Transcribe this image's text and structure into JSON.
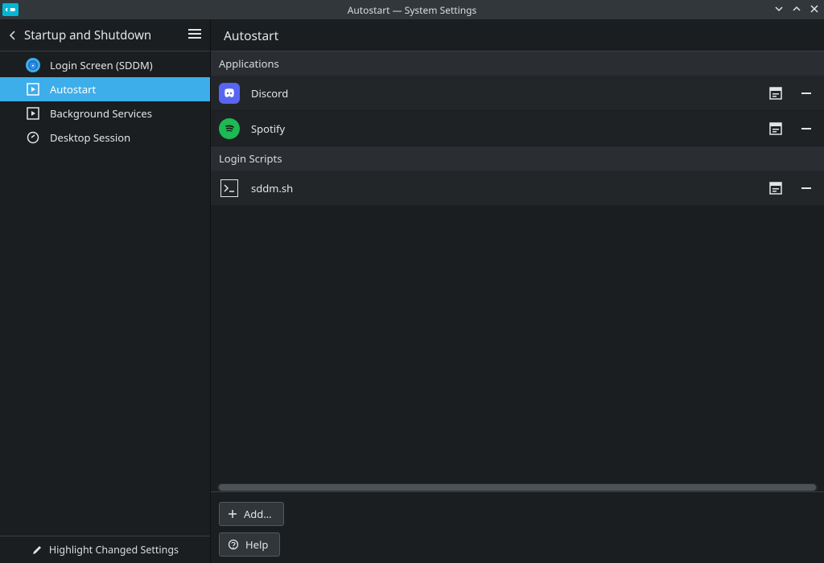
{
  "window": {
    "title": "Autostart — System Settings"
  },
  "sidebar": {
    "title": "Startup and Shutdown",
    "items": [
      {
        "label": "Login Screen (SDDM)",
        "icon": "sddm",
        "active": false
      },
      {
        "label": "Autostart",
        "icon": "autostart",
        "active": true
      },
      {
        "label": "Background Services",
        "icon": "services",
        "active": false
      },
      {
        "label": "Desktop Session",
        "icon": "session",
        "active": false
      }
    ],
    "footer": "Highlight Changed Settings"
  },
  "main": {
    "title": "Autostart",
    "sections": [
      {
        "header": "Applications",
        "items": [
          {
            "label": "Discord",
            "icon": "discord"
          },
          {
            "label": "Spotify",
            "icon": "spotify"
          }
        ]
      },
      {
        "header": "Login Scripts",
        "items": [
          {
            "label": "sddm.sh",
            "icon": "script"
          }
        ]
      }
    ],
    "buttons": {
      "add": "Add…",
      "help": "Help"
    }
  }
}
